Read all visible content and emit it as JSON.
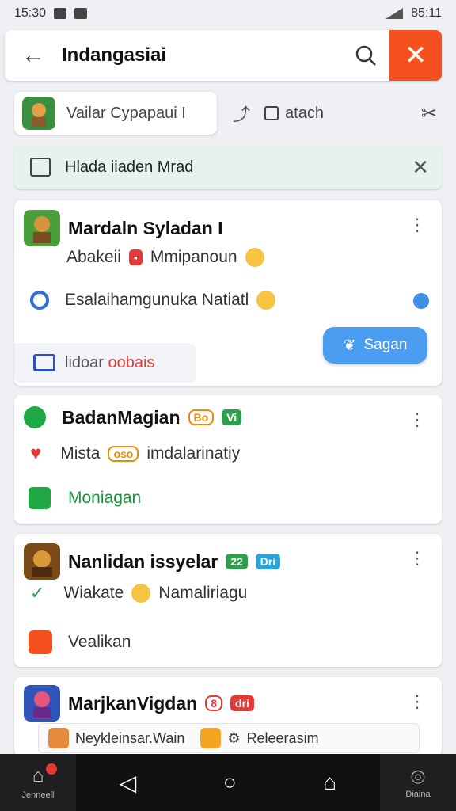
{
  "status_bar": {
    "time": "15:30",
    "right_text": "85:11"
  },
  "app_bar": {
    "title": "Indangasiai"
  },
  "filter_row": {
    "chip_label": "Vailar Cypapaui I",
    "attach_label": "atach"
  },
  "banner": {
    "text": "Hlada iiaden Mrad"
  },
  "cards": [
    {
      "title": "Mardaln Syladan I",
      "line1": "Abakeii",
      "line1_after": "Mmipanoun",
      "line2": "Esalaihamgunuka Natiatl",
      "status_grey": "lidoar",
      "status_red": "oobais",
      "action_label": "Sagan"
    },
    {
      "title": "BadanMagian",
      "badge1": "Bo",
      "badge2": "Vi",
      "line1": "Mista",
      "badge3": "oso",
      "line1_after": "imdalarinatiy",
      "line2": "Moniagan"
    },
    {
      "title": "Nanlidan issyelar",
      "badge1": "22",
      "badge2": "Dri",
      "line1": "Wiakate",
      "line1_after": "Namaliriagu",
      "line2": "Vealikan"
    },
    {
      "title": "MarjkanVigdan",
      "badge1": "8",
      "badge2": "dri",
      "sub1": "Neykleinsar.Wain",
      "sub2": "Releerasim"
    }
  ],
  "nav": {
    "left_label": "Jenneell",
    "right_label": "Diaina"
  },
  "colors": {
    "accent": "#f4511e",
    "action": "#4a9df0",
    "banner": "#e6f2ee"
  }
}
